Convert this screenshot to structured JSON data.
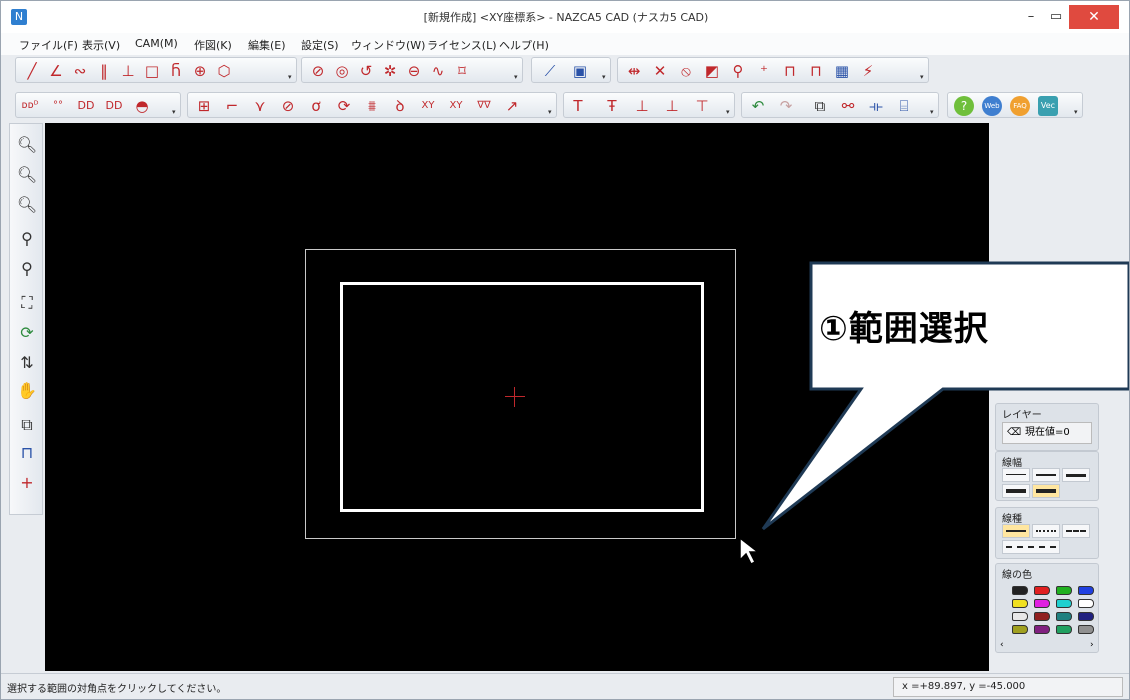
{
  "window": {
    "title": "[新規作成] <XY座標系> - NAZCA5 CAD (ナスカ5 CAD)",
    "app_icon": "nazca-logo-icon"
  },
  "menu": {
    "items": [
      {
        "label": "ファイル(F)"
      },
      {
        "label": "表示(V)"
      },
      {
        "label": "CAM(M)"
      },
      {
        "label": "作図(K)"
      },
      {
        "label": "編集(E)"
      },
      {
        "label": "設定(S)"
      },
      {
        "label": "ウィンドウ(W)"
      },
      {
        "label": "ライセンス(L)"
      },
      {
        "label": "ヘルプ(H)"
      }
    ]
  },
  "right_panel": {
    "layer_title": "レイヤー",
    "layer_value": "現在値=0",
    "linewidth_title": "線幅",
    "linetype_title": "線種",
    "linecolor_title": "線の色"
  },
  "callout": {
    "text": "①範囲選択"
  },
  "status": {
    "message": "選択する範囲の対角点をクリックしてください。",
    "coords": "x =+89.897,   y =-45.000"
  },
  "colors": {
    "canvas": "#000000",
    "drawn_rect": "#ffffff",
    "selection": "#c9c9c9",
    "origin": "#c0282c",
    "callout_border": "#1f3a55",
    "close_button": "#e04a3f"
  }
}
